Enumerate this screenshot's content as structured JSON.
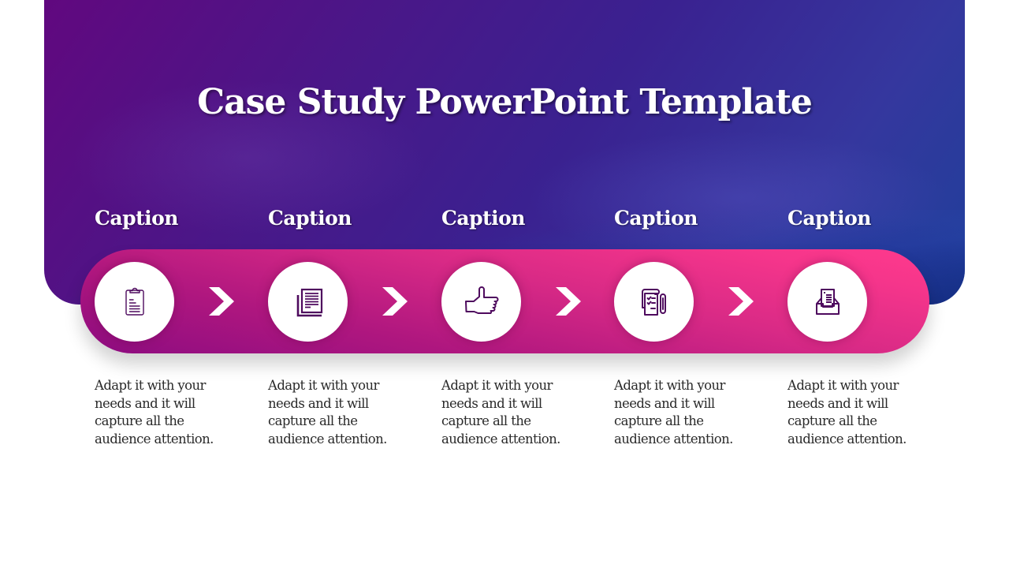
{
  "slide": {
    "title": "Case Study PowerPoint Template",
    "colors": {
      "band_start": "#8d0c80",
      "band_end": "#ff3a8c",
      "hero_start": "#61087f",
      "hero_end": "#1f3f9a",
      "icon_stroke": "#4e0a5e",
      "text_dark": "#2a2a2a"
    },
    "steps": [
      {
        "caption": "Caption",
        "icon": "clipboard-icon",
        "description": "Adapt it with your needs and it will capture all the audience attention."
      },
      {
        "caption": "Caption",
        "icon": "documents-icon",
        "description": "Adapt it with your needs and it will capture all the audience attention."
      },
      {
        "caption": "Caption",
        "icon": "thumbs-up-icon",
        "description": "Adapt it with your needs and it will capture all the audience attention."
      },
      {
        "caption": "Caption",
        "icon": "checklist-pen-icon",
        "description": "Adapt it with your needs and it will capture all the audience attention."
      },
      {
        "caption": "Caption",
        "icon": "inbox-tray-icon",
        "description": "Adapt it with your needs and it will capture all the audience attention."
      }
    ],
    "connector_icon": "chevron-right-icon"
  }
}
